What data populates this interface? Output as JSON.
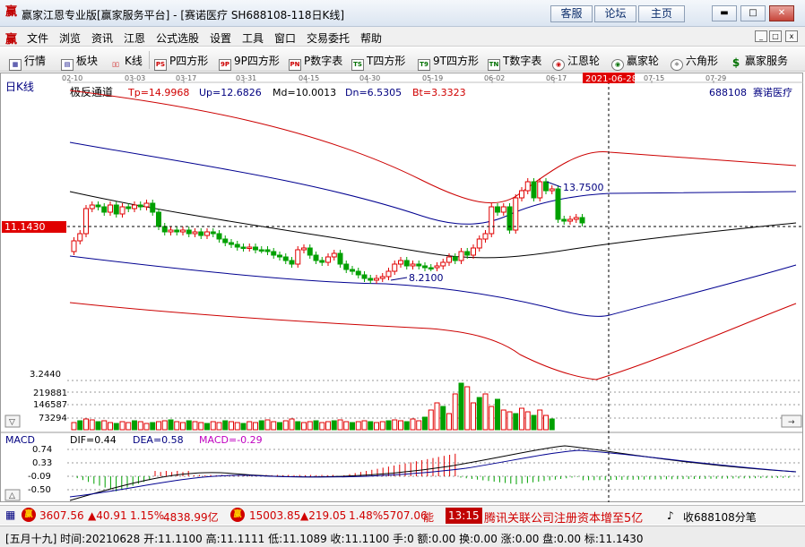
{
  "window": {
    "title": "赢家江恩专业版[赢家服务平台] - [赛诺医疗  SH688108-118日K线]",
    "buttons": [
      "客服",
      "论坛",
      "主页"
    ],
    "win_controls": [
      "minimize",
      "maximize",
      "close"
    ]
  },
  "menu": {
    "items": [
      "文件",
      "浏览",
      "资讯",
      "江恩",
      "公式选股",
      "设置",
      "工具",
      "窗口",
      "交易委托",
      "帮助"
    ],
    "mdi_controls": [
      "_",
      "□",
      "x"
    ]
  },
  "toolbar": {
    "items": [
      {
        "label": "行情",
        "icon": "grid-icon"
      },
      {
        "label": "板块",
        "icon": "sector-icon"
      },
      {
        "label": "K线",
        "icon": "candlestick-icon"
      },
      {
        "label": "P四方形",
        "icon": "ps-icon",
        "mark": "PS"
      },
      {
        "label": "9P四方形",
        "icon": "9p-icon",
        "mark": "9P"
      },
      {
        "label": "P数字表",
        "icon": "pn-icon",
        "mark": "PN"
      },
      {
        "label": "T四方形",
        "icon": "ts-icon",
        "mark": "TS"
      },
      {
        "label": "9T四方形",
        "icon": "t9-icon",
        "mark": "T9"
      },
      {
        "label": "T数字表",
        "icon": "tn-icon",
        "mark": "TN"
      },
      {
        "label": "江恩轮",
        "icon": "gann-wheel-icon"
      },
      {
        "label": "赢家轮",
        "icon": "winner-wheel-icon"
      },
      {
        "label": "六角形",
        "icon": "hexagon-icon"
      },
      {
        "label": "赢家服务",
        "icon": "dollar-icon"
      }
    ]
  },
  "chart": {
    "period_label": "日K线",
    "indicator_name": "极反通道",
    "params": [
      {
        "label": "Tp=14.9968",
        "color": "#d00000"
      },
      {
        "label": "Up=12.6826",
        "color": "#000080"
      },
      {
        "label": "Md=10.0013",
        "color": "#000000"
      },
      {
        "label": "Dn=6.5305",
        "color": "#000080"
      },
      {
        "label": "Bt=3.3323",
        "color": "#d00000"
      }
    ],
    "stock_code": "688108",
    "stock_name": "赛诺医疗",
    "date_ticks": [
      "02-10",
      "03-03",
      "03-17",
      "03-31",
      "04-15",
      "04-30",
      "05-19",
      "06-02",
      "06-17",
      "07-15",
      "07-29"
    ],
    "cursor_date": "2021-06-28",
    "current_price_label": "11.1430",
    "high_label": "13.7500",
    "low_label": "8.2100",
    "volume_axis": [
      "3.2440",
      "219881",
      "146587",
      "73294"
    ],
    "macd": {
      "name": "MACD",
      "dif": "DIF=0.44",
      "dea": "DEA=0.58",
      "macd": "MACD=-0.29",
      "axis": [
        "0.74",
        "0.33",
        "-0.09",
        "-0.50"
      ]
    },
    "colors": {
      "up": "#e00000",
      "down": "#00a000",
      "channel_outer": "#cc0000",
      "channel_inner": "#000090",
      "middle": "#000000"
    }
  },
  "ticker": {
    "sh_index": "3607.56",
    "sh_change": "▲40.91",
    "sh_pct": "1.15%",
    "sh_amount": "4838.99亿",
    "sz_index": "15003.85",
    "sz_change": "▲219.05",
    "sz_pct": "1.48%",
    "sz_amount": "5707.06",
    "news_tail": "能",
    "news_time": "13:15",
    "news_text": "腾讯关联公司注册资本增至5亿",
    "watch_label": "收688108分笔"
  },
  "status": {
    "text": "[五月十九] 时间:20210628 开:11.1100 高:11.1111 低:11.1089 收:11.1100 手:0 额:0.00 换:0.00 涨:0.00 盘:0.00 标:11.1430"
  }
}
